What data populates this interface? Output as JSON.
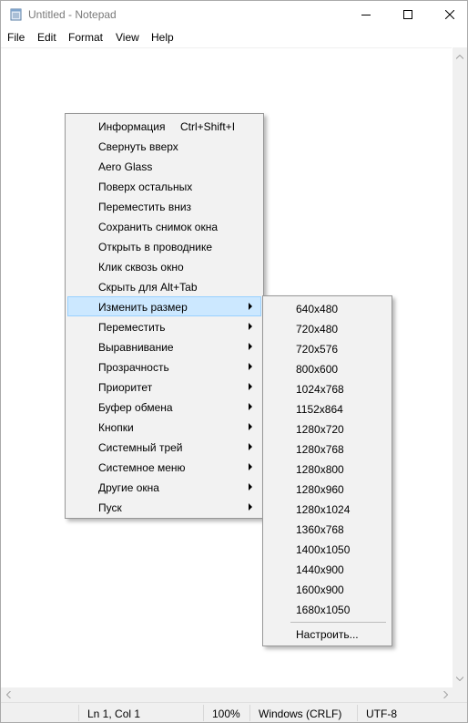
{
  "window": {
    "title": "Untitled - Notepad"
  },
  "menubar": {
    "items": [
      "File",
      "Edit",
      "Format",
      "View",
      "Help"
    ]
  },
  "statusbar": {
    "position": "Ln 1, Col 1",
    "zoom": "100%",
    "line_ending": "Windows (CRLF)",
    "encoding": "UTF-8"
  },
  "context_menu": {
    "items": [
      {
        "label": "Информация",
        "shortcut": "Ctrl+Shift+I",
        "submenu": false
      },
      {
        "label": "Свернуть вверх",
        "submenu": false
      },
      {
        "label": "Aero Glass",
        "submenu": false
      },
      {
        "label": "Поверх остальных",
        "submenu": false
      },
      {
        "label": "Переместить вниз",
        "submenu": false
      },
      {
        "label": "Сохранить снимок окна",
        "submenu": false
      },
      {
        "label": "Открыть в проводнике",
        "submenu": false
      },
      {
        "label": "Клик сквозь окно",
        "submenu": false
      },
      {
        "label": "Скрыть для Alt+Tab",
        "submenu": false
      },
      {
        "label": "Изменить размер",
        "submenu": true,
        "highlighted": true
      },
      {
        "label": "Переместить",
        "submenu": true
      },
      {
        "label": "Выравнивание",
        "submenu": true
      },
      {
        "label": "Прозрачность",
        "submenu": true
      },
      {
        "label": "Приоритет",
        "submenu": true
      },
      {
        "label": "Буфер обмена",
        "submenu": true
      },
      {
        "label": "Кнопки",
        "submenu": true
      },
      {
        "label": "Системный трей",
        "submenu": true
      },
      {
        "label": "Системное меню",
        "submenu": true
      },
      {
        "label": "Другие окна",
        "submenu": true
      },
      {
        "label": "Пуск",
        "submenu": true
      }
    ]
  },
  "resize_submenu": {
    "items": [
      "640x480",
      "720x480",
      "720x576",
      "800x600",
      "1024x768",
      "1152x864",
      "1280x720",
      "1280x768",
      "1280x800",
      "1280x960",
      "1280x1024",
      "1360x768",
      "1400x1050",
      "1440x900",
      "1600x900",
      "1680x1050"
    ],
    "custom_label": "Настроить..."
  },
  "colors": {
    "highlight_bg": "#cce8ff",
    "highlight_border": "#99d1ff",
    "menu_bg": "#f2f2f2"
  }
}
